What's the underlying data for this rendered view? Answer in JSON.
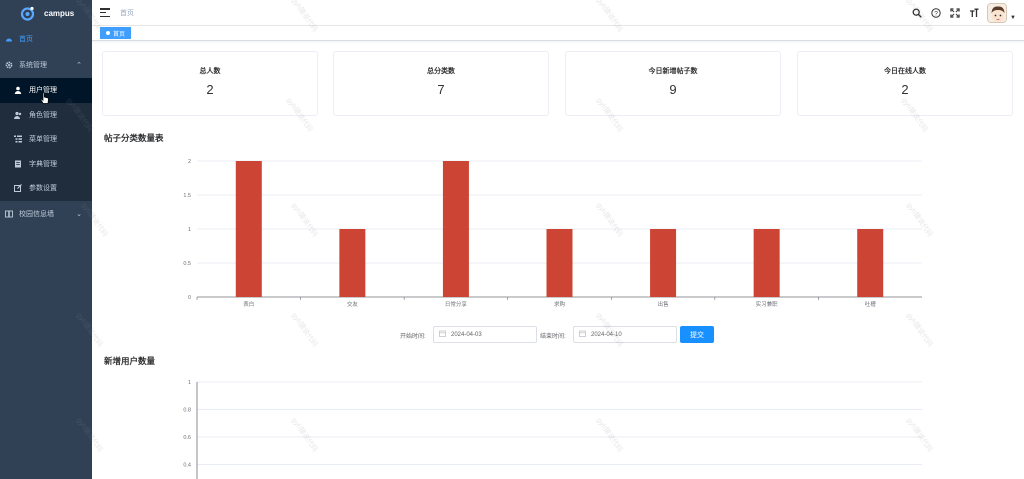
{
  "app": {
    "name": "campus"
  },
  "sidebar": {
    "home": "首页",
    "system_group": {
      "label": "系统管理",
      "expanded": true
    },
    "sub_items": [
      {
        "label": "用户管理",
        "icon": "user-icon",
        "active": true
      },
      {
        "label": "角色管理",
        "icon": "user-group-icon",
        "active": false
      },
      {
        "label": "菜单管理",
        "icon": "tree-table-icon",
        "active": false
      },
      {
        "label": "字典管理",
        "icon": "dict-icon",
        "active": false
      },
      {
        "label": "参数设置",
        "icon": "edit-icon",
        "active": false
      }
    ],
    "campus_group": {
      "label": "校园信息墙",
      "expanded": false
    }
  },
  "header": {
    "breadcrumb": "首页"
  },
  "tags": {
    "home": "首页"
  },
  "stats": [
    {
      "title": "总人数",
      "value": "2"
    },
    {
      "title": "总分类数",
      "value": "7"
    },
    {
      "title": "今日新增帖子数",
      "value": "9"
    },
    {
      "title": "今日在线人数",
      "value": "2"
    }
  ],
  "post_chart": {
    "title": "帖子分类数量表",
    "chart_data": {
      "type": "bar",
      "categories": [
        "表白",
        "交友",
        "日常分享",
        "求购",
        "出售",
        "实习兼职",
        "吐槽"
      ],
      "values": [
        2,
        1,
        2,
        1,
        1,
        1,
        1
      ],
      "ylim": [
        0,
        2
      ],
      "yticks": [
        "0",
        "0.5",
        "1",
        "1.5",
        "2"
      ],
      "color": "#cc4433",
      "grid": true
    }
  },
  "filter": {
    "start_label": "开始时间:",
    "start_value": "2024-04-03",
    "end_label": "结束时间:",
    "end_value": "2024-04-10",
    "submit": "提交"
  },
  "user_chart": {
    "title": "新增用户数量",
    "chart_data": {
      "type": "line",
      "ylim": [
        0,
        1
      ],
      "yticks": [
        "1",
        "0.8",
        "0.6",
        "0.4"
      ],
      "grid": true
    }
  },
  "watermark": "gyh猿说代码"
}
